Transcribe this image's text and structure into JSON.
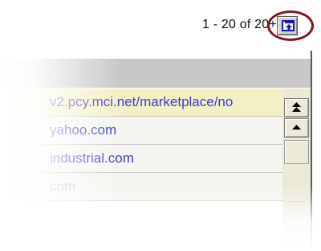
{
  "pager": {
    "text": "1 - 20 of 20+",
    "separator": "·"
  },
  "toolbar": {
    "icon": "move-to-top-icon"
  },
  "list": {
    "rows": [
      {
        "text": "v2.pcy.mci.net/marketplace/no"
      },
      {
        "text": "yahoo.com"
      },
      {
        "text": "industrial.com"
      },
      {
        "text": "com"
      }
    ]
  },
  "scrollbar": {
    "top_button_icon": "scroll-to-top-icon",
    "up_button_icon": "scroll-up-icon"
  },
  "colors": {
    "link": "#3b3bd0",
    "highlight_row": "#f3f0c6",
    "annotation_circle": "#8a1020"
  }
}
